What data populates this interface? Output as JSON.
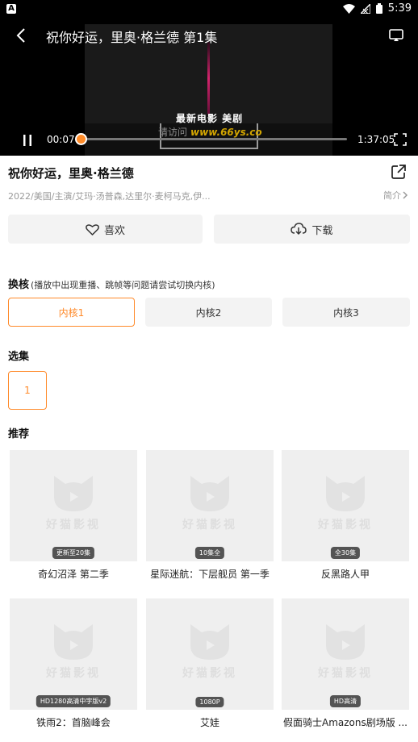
{
  "status_bar": {
    "app_icon_label": "A",
    "time": "5:39"
  },
  "player": {
    "title": "祝你好运，里奥·格兰德 第1集",
    "watermark_title": "最新电影 美剧",
    "watermark_prefix": "请访问",
    "watermark_url": "www.66ys.co",
    "current_time": "00:07",
    "total_time": "1:37:05",
    "progress_fraction": 0.0012
  },
  "info": {
    "title": "祝你好运，里奥·格兰德",
    "meta": "2022/美国/主演/艾玛·汤普森,达里尔·麦柯马克,伊...",
    "intro_label": "简介"
  },
  "actions": {
    "like_label": "喜欢",
    "download_label": "下载"
  },
  "cores": {
    "heading": "换核",
    "hint": "(播放中出现重播、跳帧等问题请尝试切换内核)",
    "options": [
      "内核1",
      "内核2",
      "内核3"
    ],
    "selected": "内核1"
  },
  "episodes": {
    "heading": "选集",
    "items": [
      "1"
    ]
  },
  "recommend": {
    "heading": "推荐",
    "placeholder_brand": "好猫影视",
    "items": [
      {
        "name": "奇幻沼泽 第二季",
        "badge": "更新至20集"
      },
      {
        "name": "星际迷航：下层舰员 第一季",
        "badge": "10集全"
      },
      {
        "name": "反黑路人甲",
        "badge": "全30集"
      },
      {
        "name": "铁雨2：首脑峰会",
        "badge": "HD1280高清中字版v2"
      },
      {
        "name": "艾娃",
        "badge": "1080P"
      },
      {
        "name": "假面骑士Amazons剧场版 ...",
        "badge": "HD高清"
      }
    ]
  },
  "colors": {
    "accent": "#ff8a2a",
    "video_bg": "#000000",
    "button_bg": "#f3f3f3"
  }
}
